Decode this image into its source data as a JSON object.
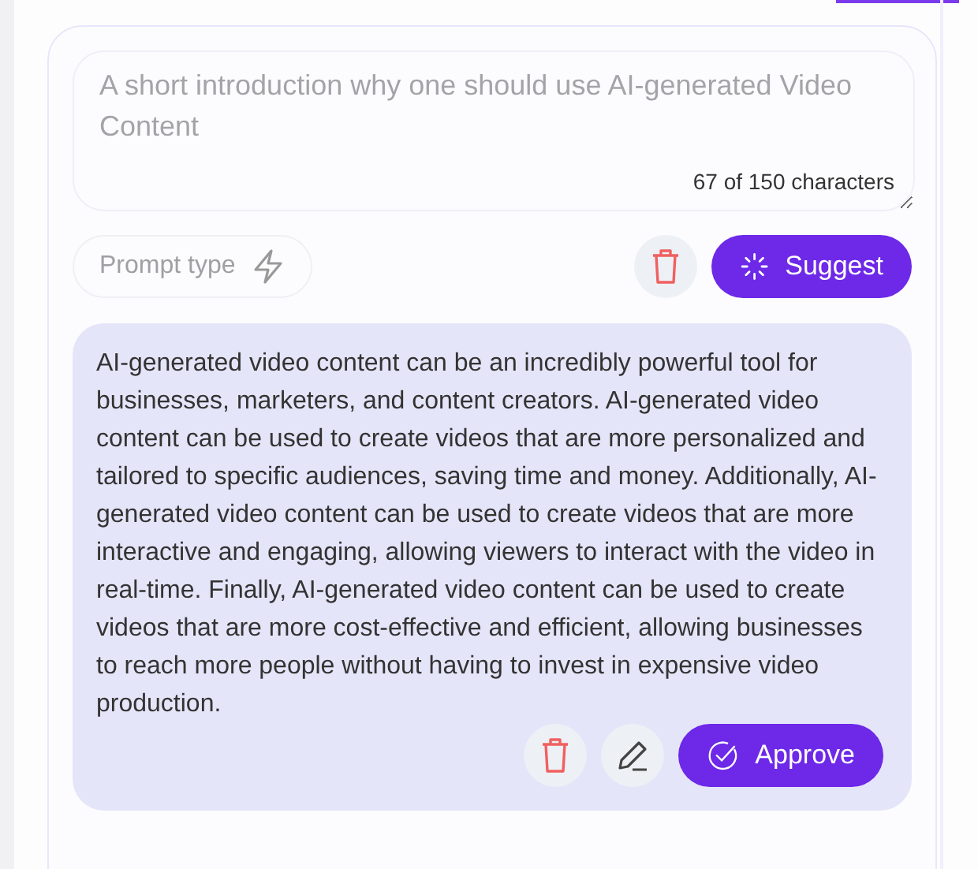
{
  "prompt": {
    "value": "A short introduction why one should use AI-generated Video Content",
    "counter": "67 of 150 characters"
  },
  "prompt_type": {
    "label": "Prompt type"
  },
  "actions": {
    "suggest": "Suggest"
  },
  "result": {
    "text": "AI-generated video content can be an incredibly powerful tool for businesses, marketers, and content creators. AI-generated video content can be used to create videos that are more personalized and tailored to specific audiences, saving time and money. Additionally, AI-generated video content can be used to create videos that are more interactive and engaging, allowing viewers to interact with the video in real-time. Finally, AI-generated video content can be used to create videos that are more cost-effective and efficient, allowing businesses to reach more people without having to invest in expensive video production.",
    "approve": "Approve"
  }
}
